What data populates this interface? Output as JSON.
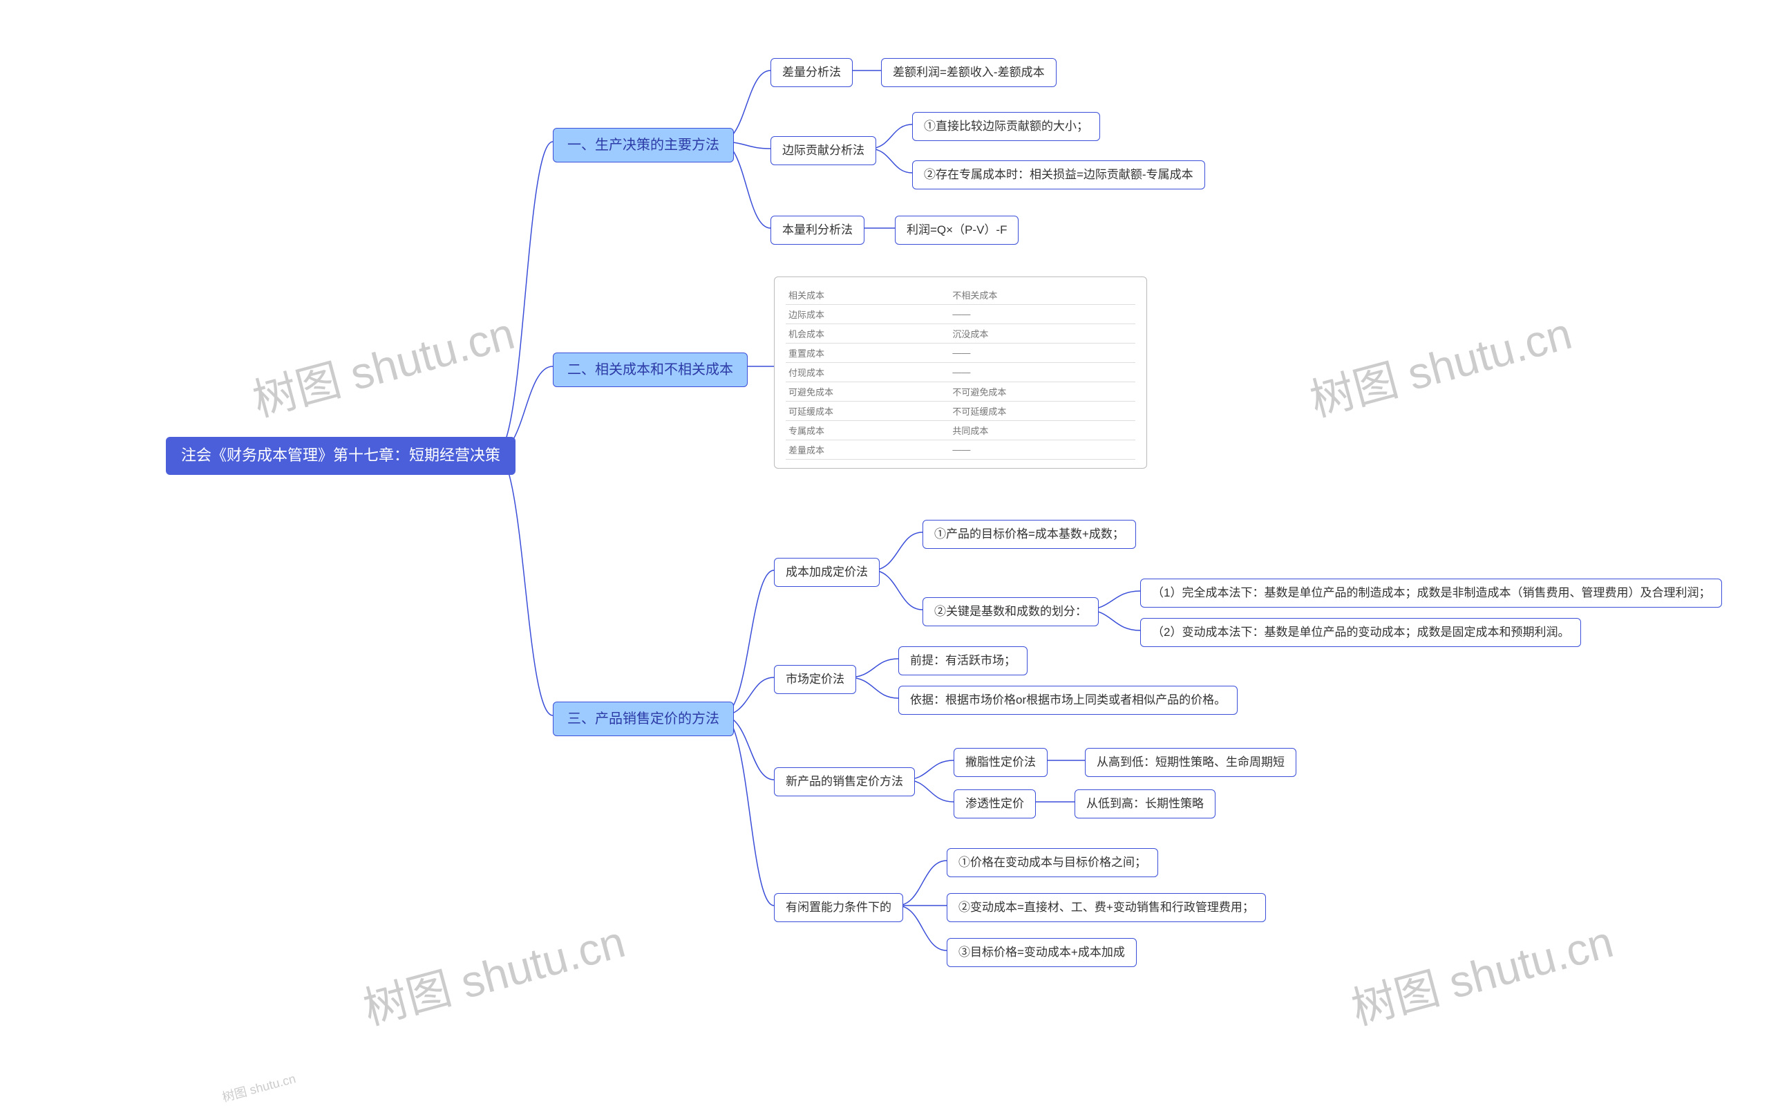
{
  "watermark_text": "树图 shutu.cn",
  "root": "注会《财务成本管理》第十七章：短期经营决策",
  "branch1": {
    "title": "一、生产决策的主要方法",
    "a": "差量分析法",
    "a1": "差额利润=差额收入-差额成本",
    "b": "边际贡献分析法",
    "b1": "①直接比较边际贡献额的大小；",
    "b2": "②存在专属成本时：相关损益=边际贡献额-专属成本",
    "c": "本量利分析法",
    "c1": "利润=Q×（P-V）-F"
  },
  "branch2": {
    "title": "二、相关成本和不相关成本",
    "table": [
      [
        "相关成本",
        "不相关成本"
      ],
      [
        "边际成本",
        "——"
      ],
      [
        "机会成本",
        "沉没成本"
      ],
      [
        "重置成本",
        "——"
      ],
      [
        "付现成本",
        "——"
      ],
      [
        "可避免成本",
        "不可避免成本"
      ],
      [
        "可延缓成本",
        "不可延缓成本"
      ],
      [
        "专属成本",
        "共同成本"
      ],
      [
        "差量成本",
        "——"
      ]
    ]
  },
  "branch3": {
    "title": "三、产品销售定价的方法",
    "a": "成本加成定价法",
    "a1": "①产品的目标价格=成本基数+成数；",
    "a2": "②关键是基数和成数的划分：",
    "a2_1": "（1）完全成本法下：基数是单位产品的制造成本；成数是非制造成本（销售费用、管理费用）及合理利润；",
    "a2_2": "（2）变动成本法下：基数是单位产品的变动成本；成数是固定成本和预期利润。",
    "b": "市场定价法",
    "b1": "前提：有活跃市场；",
    "b2": "依据：根据市场价格or根据市场上同类或者相似产品的价格。",
    "c": "新产品的销售定价方法",
    "c1": "撇脂性定价法",
    "c1_1": "从高到低：短期性策略、生命周期短",
    "c2": "渗透性定价",
    "c2_1": "从低到高：长期性策略",
    "d": "有闲置能力条件下的",
    "d1": "①价格在变动成本与目标价格之间；",
    "d2": "②变动成本=直接材、工、费+变动销售和行政管理费用；",
    "d3": "③目标价格=变动成本+成本加成"
  }
}
